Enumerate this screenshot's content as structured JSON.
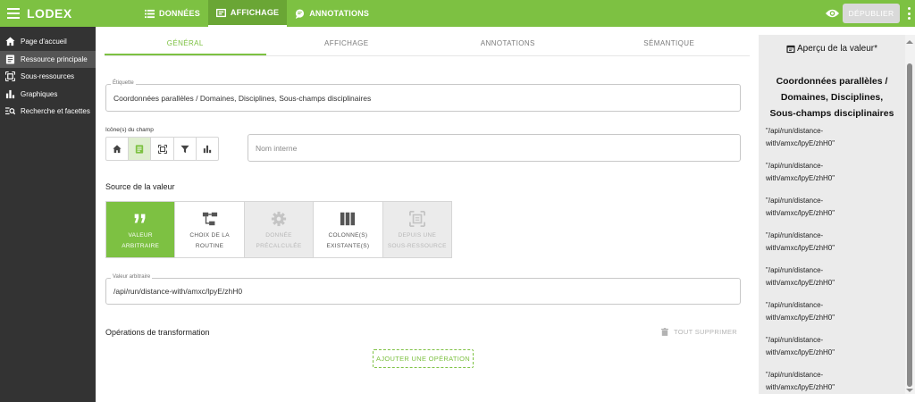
{
  "app": {
    "logo": "LODEX"
  },
  "topnav": [
    {
      "label": "DONNÉES",
      "icon": "list-icon",
      "active": false
    },
    {
      "label": "AFFICHAGE",
      "icon": "display-icon",
      "active": true
    },
    {
      "label": "ANNOTATIONS",
      "icon": "comment-icon",
      "active": false
    }
  ],
  "header": {
    "publish_label": "DÉPUBLIER"
  },
  "sidebar": {
    "items": [
      {
        "label": "Page d'accueil",
        "icon": "home-icon",
        "active": false
      },
      {
        "label": "Ressource principale",
        "icon": "document-icon",
        "active": true
      },
      {
        "label": "Sous-ressources",
        "icon": "subresource-icon",
        "active": false
      },
      {
        "label": "Graphiques",
        "icon": "chart-icon",
        "active": false
      },
      {
        "label": "Recherche et facettes",
        "icon": "search-list-icon",
        "active": false
      }
    ]
  },
  "subtabs": [
    {
      "label": "GÉNÉRAL",
      "active": true
    },
    {
      "label": "AFFICHAGE",
      "active": false
    },
    {
      "label": "ANNOTATIONS",
      "active": false
    },
    {
      "label": "SÉMANTIQUE",
      "active": false
    }
  ],
  "form": {
    "label_field": {
      "label": "Étiquette",
      "value": "Coordonnées parallèles / Domaines, Disciplines, Sous-champs disciplinaires"
    },
    "icons_label": "Icône(s) du champ",
    "icon_buttons": [
      "home-icon",
      "document-icon",
      "subresource-icon",
      "filter-icon",
      "chart-icon"
    ],
    "internal_name": {
      "placeholder": "Nom interne"
    },
    "source_heading": "Source de la valeur",
    "sources": [
      {
        "line1": "VALEUR",
        "line2": "ARBITRAIRE",
        "icon": "quote-icon",
        "state": "selected"
      },
      {
        "line1": "CHOIX DE LA",
        "line2": "ROUTINE",
        "icon": "routine-icon",
        "state": "normal"
      },
      {
        "line1": "DONNÉE",
        "line2": "PRÉCALCULÉE",
        "icon": "gear-icon",
        "state": "disabled"
      },
      {
        "line1": "COLONNE(S)",
        "line2": "EXISTANTE(S)",
        "icon": "columns-icon",
        "state": "normal"
      },
      {
        "line1": "DEPUIS UNE",
        "line2": "SOUS-RESSOURCE",
        "icon": "subresource-icon",
        "state": "disabled"
      }
    ],
    "arbitrary_value": {
      "label": "Valeur arbitraire",
      "value": "/api/run/distance-with/amxc/lpyE/zhH0"
    },
    "operations_heading": "Opérations de transformation",
    "delete_all_label": "TOUT SUPPRIMER",
    "add_operation_label": "AJOUTER UNE OPÉRATION"
  },
  "preview": {
    "title": "Aperçu de la valeur*",
    "heading": [
      "Coordonnées parallèles /",
      "Domaines, Disciplines,",
      "Sous-champs disciplinaires"
    ],
    "values": [
      [
        "\"/api/run/distance-",
        "with/amxc/lpyE/zhH0\""
      ],
      [
        "\"/api/run/distance-",
        "with/amxc/lpyE/zhH0\""
      ],
      [
        "\"/api/run/distance-",
        "with/amxc/lpyE/zhH0\""
      ],
      [
        "\"/api/run/distance-",
        "with/amxc/lpyE/zhH0\""
      ],
      [
        "\"/api/run/distance-",
        "with/amxc/lpyE/zhH0\""
      ],
      [
        "\"/api/run/distance-",
        "with/amxc/lpyE/zhH0\""
      ],
      [
        "\"/api/run/distance-",
        "with/amxc/lpyE/zhH0\""
      ],
      [
        "\"/api/run/distance-",
        "with/amxc/lpyE/zhH0\""
      ]
    ]
  },
  "colors": {
    "accent": "#7dc142",
    "sidebar": "#333333",
    "preview_bg": "#ebebeb"
  }
}
